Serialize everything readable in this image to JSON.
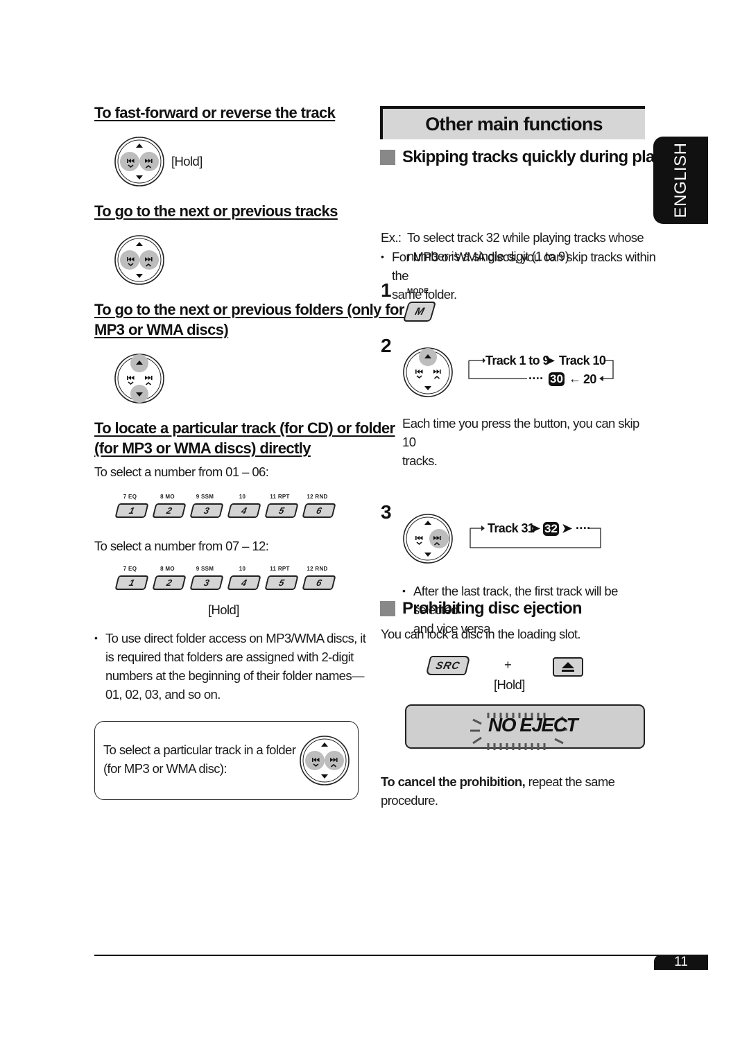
{
  "left_column": {
    "ff_rev": {
      "heading": "To fast-forward or reverse the track",
      "hold_label": "[Hold]"
    },
    "next_prev_tracks": {
      "heading": "To go to the next or previous tracks"
    },
    "next_prev_folders": {
      "heading_line1": "To go to the next or previous folders (only for",
      "heading_line2": "MP3 or WMA discs)"
    },
    "locate_direct": {
      "heading_line1": "To locate a particular track (for CD) or folder",
      "heading_line2": "(for MP3 or WMA discs) directly",
      "range1_label": "To select a number from 01 – 06:",
      "range2_label": "To select a number from 07 – 12:",
      "hold_label": "[Hold]",
      "presets": [
        {
          "top": "7  EQ",
          "num": "1"
        },
        {
          "top": "8  MO",
          "num": "2"
        },
        {
          "top": "9  SSM",
          "num": "3"
        },
        {
          "top": "10",
          "num": "4"
        },
        {
          "top": "11  RPT",
          "num": "5"
        },
        {
          "top": "12  RND",
          "num": "6"
        }
      ],
      "note_lines": [
        "To use direct folder access on MP3/WMA discs, it",
        "is required that folders are assigned with 2-digit",
        "numbers at the beginning of their folder names—",
        "01, 02, 03, and so on."
      ]
    },
    "folder_box": {
      "line1": "To select a particular track in a folder",
      "line2": "(for MP3 or WMA disc):"
    }
  },
  "right_column": {
    "header": "Other main functions",
    "skip": {
      "title": "Skipping tracks quickly during play",
      "bullet_line1": "For MP3 or WMA discs, you can skip tracks within the",
      "bullet_line2": "same folder.",
      "ex_label": "Ex.:",
      "ex_line1": "To select track 32 while playing tracks whose",
      "ex_line2": "number is a single digit (1 to 9)",
      "step1": {
        "num": "1",
        "button_caption": "MODE",
        "button_label": "M"
      },
      "step2": {
        "num": "2",
        "flow_a": "Track 1 to 9",
        "flow_b": "Track 10",
        "flow_c": "20",
        "flow_badge": "30",
        "flow_dots": "····"
      },
      "step2_text_line1": "Each time you press the button, you can skip 10",
      "step2_text_line2": "tracks.",
      "step2_bullet_line1": "After the last track, the first track will be selected",
      "step2_bullet_line2": "and vice versa.",
      "step3": {
        "num": "3",
        "flow_a": "Track 31",
        "flow_badge": "32",
        "flow_dots": "····"
      }
    },
    "eject": {
      "title": "Prohibiting disc ejection",
      "intro": "You can lock a disc in the loading slot.",
      "src_label": "SRC",
      "plus": "+",
      "hold_label": "[Hold]",
      "lcd_text": "NO EJECT",
      "cancel_bold": "To cancel the prohibition,",
      "cancel_rest": " repeat the same",
      "cancel_line2": "procedure."
    }
  },
  "side_tab": "ENGLISH",
  "page_number": "11"
}
